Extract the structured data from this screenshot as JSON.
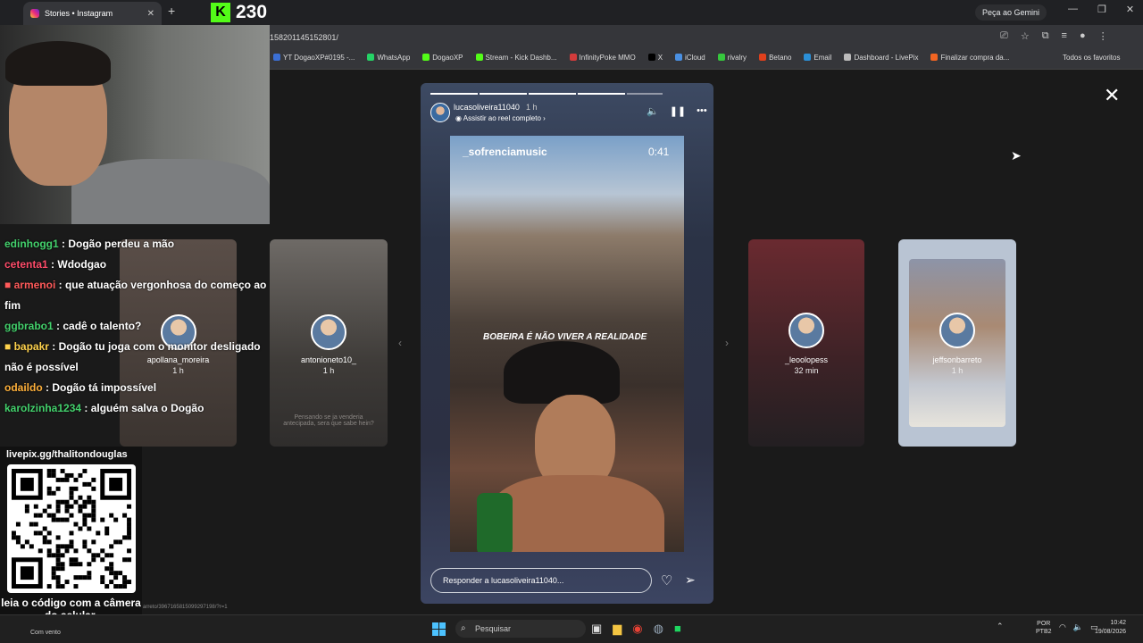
{
  "browser": {
    "tab_title": "Stories • Instagram",
    "kick_counter": "230",
    "gemini_button": "Peça ao Gemini",
    "url": "158201145152801/",
    "all_favorites": "Todos os favoritos",
    "bookmarks": [
      {
        "label": "YT DogaoXP#0195 -...",
        "color": "#3b6fd4"
      },
      {
        "label": "WhatsApp",
        "color": "#25d366"
      },
      {
        "label": "DogaoXP",
        "color": "#53fc18"
      },
      {
        "label": "Stream - Kick Dashb...",
        "color": "#53fc18"
      },
      {
        "label": "InfinityPoke MMO",
        "color": "#d23b3b"
      },
      {
        "label": "X",
        "color": "#000000"
      },
      {
        "label": "iCloud",
        "color": "#4a90e2"
      },
      {
        "label": "rivalry",
        "color": "#36c73d"
      },
      {
        "label": "Betano",
        "color": "#e0401c"
      },
      {
        "label": "Email",
        "color": "#2b8fd6"
      },
      {
        "label": "Dashboard - LivePix",
        "color": "#bbbbbb"
      },
      {
        "label": "Finalizar compra da...",
        "color": "#f26522"
      }
    ]
  },
  "story": {
    "username": "lucasoliveira11040",
    "time": "1 h",
    "reel_link": "Assistir ao reel completo",
    "media_account": "_sofrenciamusic",
    "media_time": "0:41",
    "caption": "BOBEIRA É NÃO VIVER A REALIDADE",
    "reply_placeholder": "Responder a lucasoliveira11040..."
  },
  "side_cards": [
    {
      "name": "apollana_moreira",
      "time": "1 h"
    },
    {
      "name": "antonioneto10_",
      "time": "1 h",
      "note": "Pensando se ja venderia antecipada, sera que sabe hein?"
    },
    {
      "name": "_leoolopess",
      "time": "32 min"
    },
    {
      "name": "jeffsonbarreto",
      "time": "1 h"
    }
  ],
  "chat": [
    {
      "user": "edinhogg1",
      "color": "#43d16c",
      "msg": "Dogão perdeu a mão"
    },
    {
      "user": "cetenta1",
      "color": "#ff4c6a",
      "msg": "Wdodgao"
    },
    {
      "user": "armenoi",
      "color": "#ff5a5a",
      "msg": "que atuação vergonhosa do começo ao fim",
      "badge": true
    },
    {
      "user": "ggbrabo1",
      "color": "#43d16c",
      "msg": "cadê o talento?"
    },
    {
      "user": "bapakr",
      "color": "#ffd34d",
      "msg": "Dogão tu joga com o monitor desligado não é possível",
      "badge": true
    },
    {
      "user": "odaildo",
      "color": "#ffb13b",
      "msg": "Dogão tá impossível"
    },
    {
      "user": "karolzinha1234",
      "color": "#43d16c",
      "msg": "alguém salva o Dogão"
    }
  ],
  "livepix": {
    "handle": "livepix.gg/thalitondouglas",
    "instruction": "leia o código com a câmera do celular."
  },
  "status_url": "arreto/3967165815099297198/?r=1",
  "taskbar": {
    "weather": "Com vento",
    "search_placeholder": "Pesquisar",
    "lang_top": "POR",
    "lang_bottom": "PTB2",
    "time": "10:42",
    "date": "19/08/2026"
  }
}
